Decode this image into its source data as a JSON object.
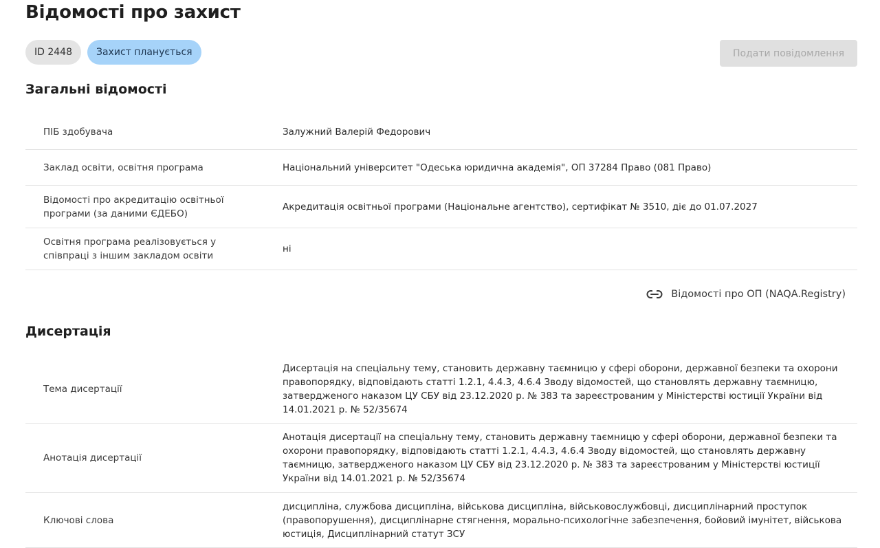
{
  "page": {
    "title": "Відомості про захист"
  },
  "badges": {
    "id": "ID 2448",
    "status": "Захист планується"
  },
  "actions": {
    "submit_label": "Подати повідомлення"
  },
  "general": {
    "title": "Загальні відомості",
    "rows": [
      {
        "label": "ПІБ здобувача",
        "value": "Залужний Валерій Федорович"
      },
      {
        "label": "Заклад освіти, освітня програма",
        "value": "Національний університет \"Одеська юридична академія\", ОП 37284 Право (081 Право)"
      },
      {
        "label": "Відомості про акредитацію освітньої програми (за даними ЄДЕБО)",
        "value": "Акредитація освітньої програми (Національне агентство), сертифікат № 3510, діє до 01.07.2027"
      },
      {
        "label": "Освітня програма реалізовується у співпраці з іншим закладом освіти",
        "value": "ні"
      }
    ],
    "link_label": "Відомості про ОП (NAQA.Registry)",
    "link_icon": "link-icon"
  },
  "dissertation": {
    "title": "Дисертація",
    "rows": [
      {
        "label": "Тема дисертації",
        "value": "Дисертація на спеціальну тему, становить державну таємницю у сфері оборони, державної безпеки та охорони правопорядку, відповідають статті 1.2.1, 4.4.3, 4.6.4 Зводу відомостей, що становлять державну таємницю, затвердженого наказом ЦУ СБУ від 23.12.2020 р. № 383 та зареєстрованим у Міністерстві юстиції України від 14.01.2021 р. № 52/35674"
      },
      {
        "label": "Анотація дисертації",
        "value": "Анотація дисертації на спеціальну тему, становить державну таємницю у сфері оборони, державної безпеки та охорони правопорядку, відповідають статті 1.2.1, 4.4.3, 4.6.4 Зводу відомостей, що становлять державну таємницю, затвердженого наказом ЦУ СБУ від 23.12.2020 р. № 383 та зареєстрованим у Міністерстві юстиції України від 14.01.2021 р. № 52/35674"
      },
      {
        "label": "Ключові слова",
        "value": "дисципліна, службова дисципліна, військова дисципліна, військовослужбовці, дисциплінарний проступок (правопорушення), дисциплінарне стягнення, морально-психологічне забезпечення, бойовий імунітет, військова юстиція, Дисциплінарний статут ЗСУ"
      }
    ]
  }
}
